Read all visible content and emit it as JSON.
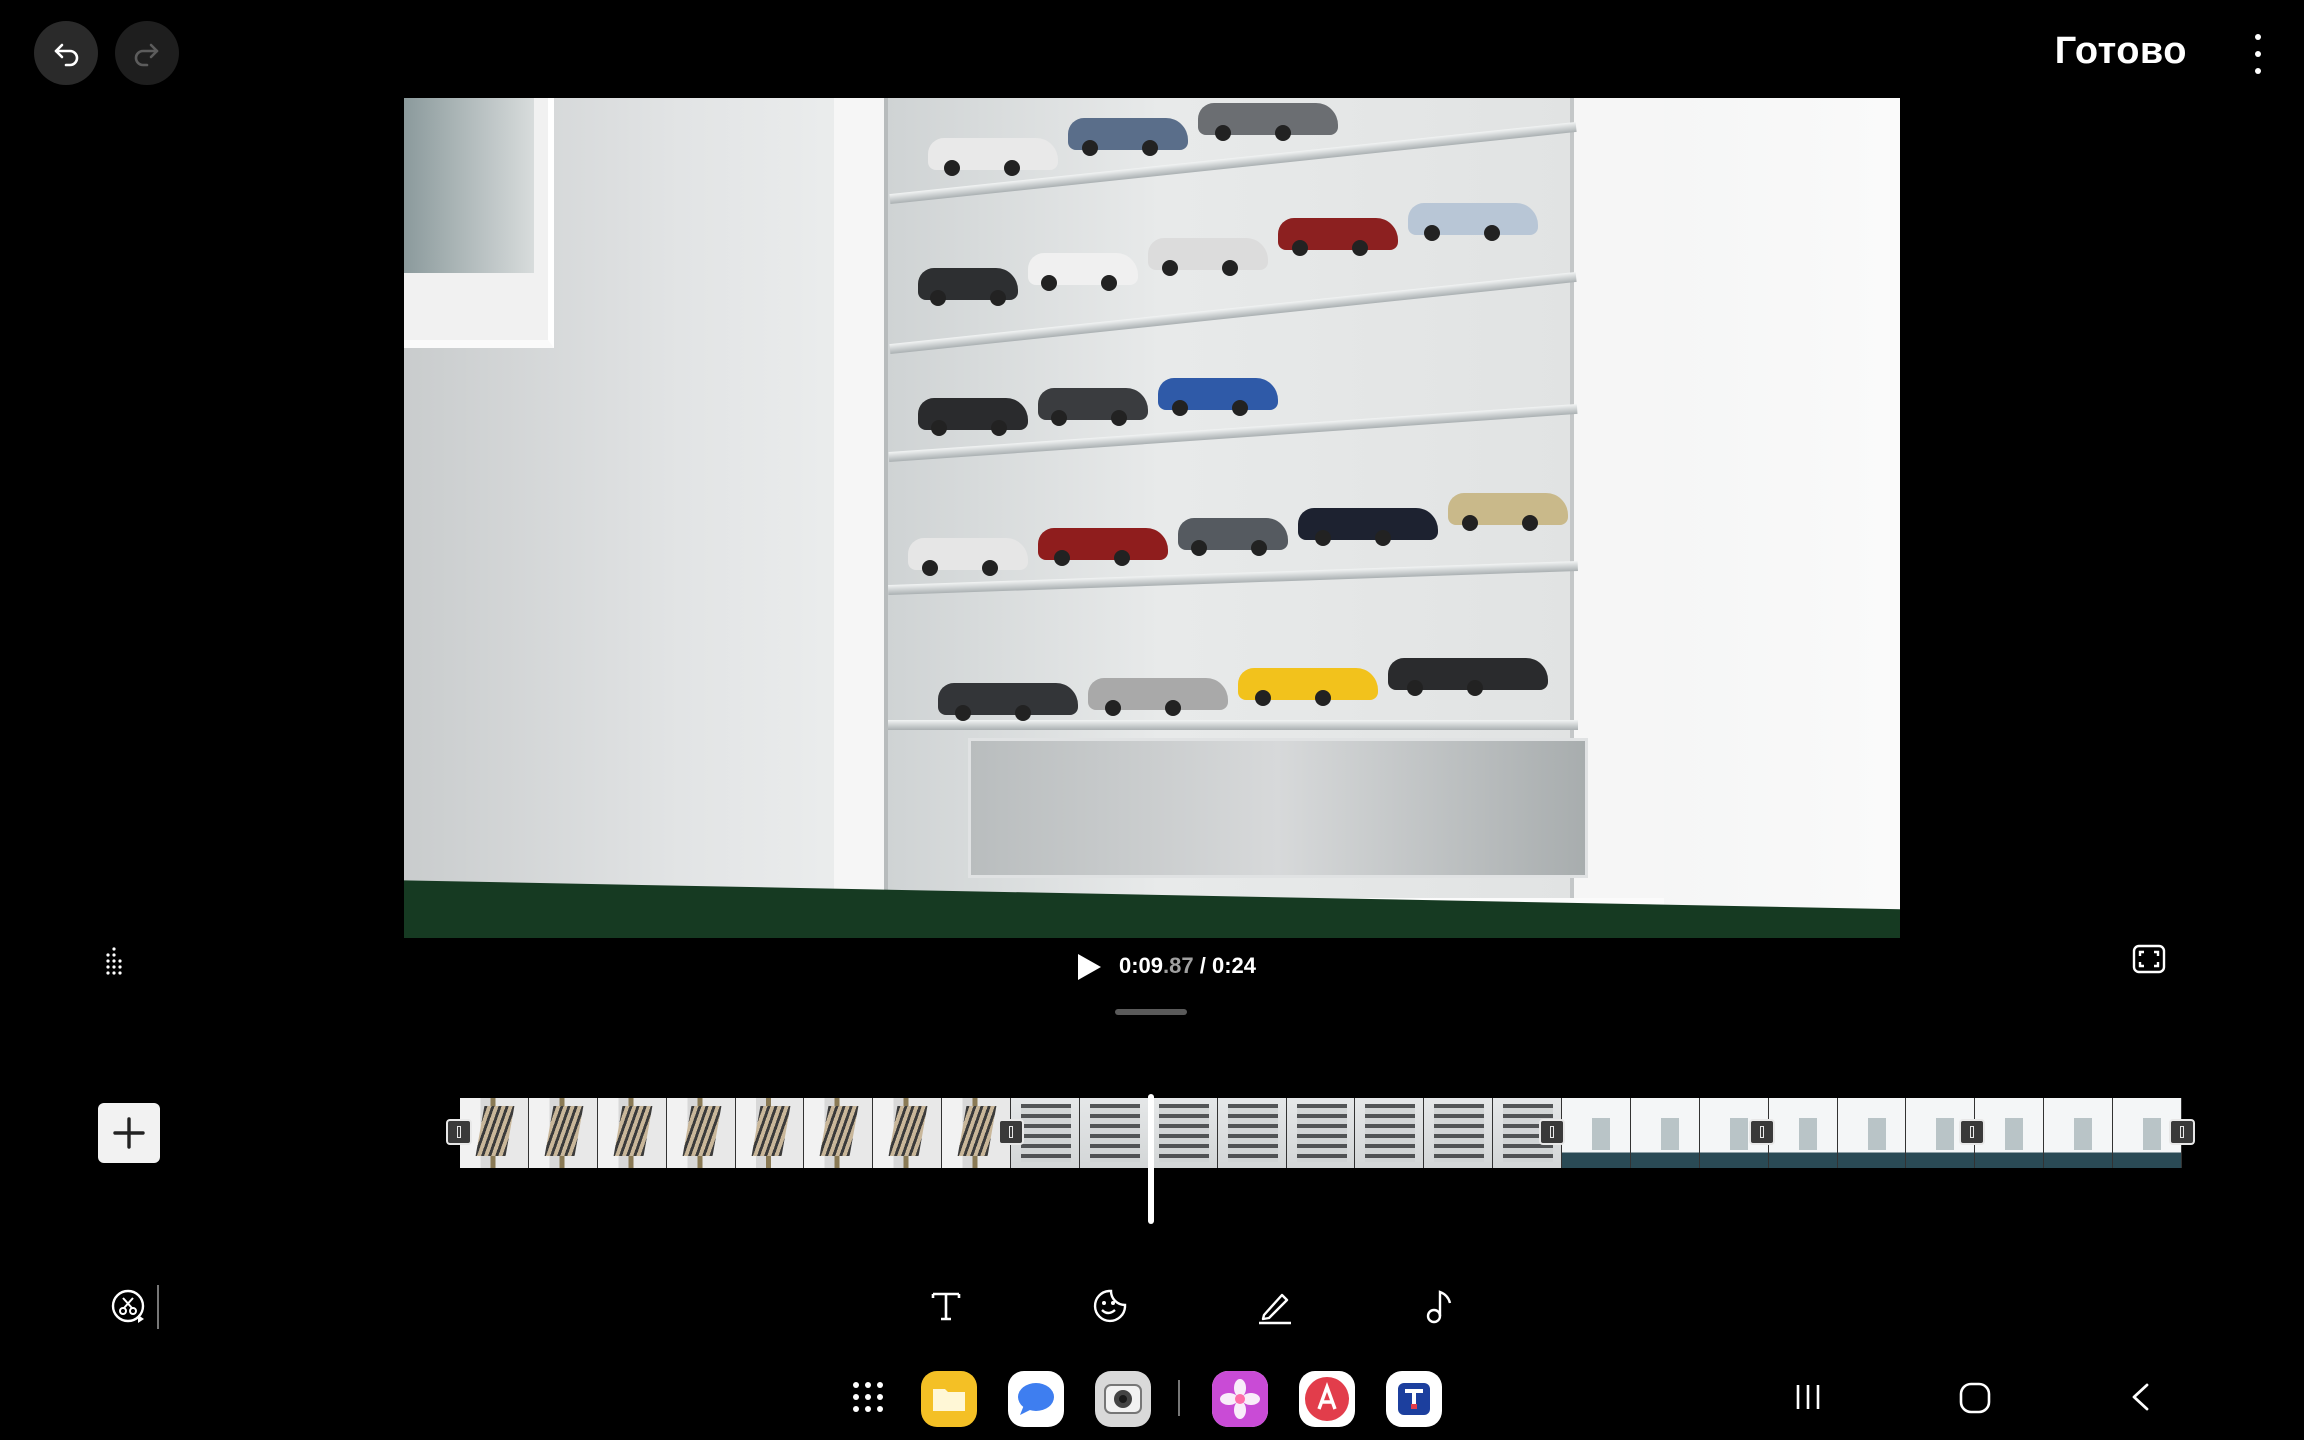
{
  "header": {
    "undo_icon": "undo-icon",
    "redo_icon": "redo-icon",
    "done_label": "Готово",
    "more_icon": "more-vertical-icon"
  },
  "player": {
    "current_time_main": "0:09",
    "current_time_fraction": ".87",
    "separator": " / ",
    "total_time": "0:24",
    "play_icon": "play-icon",
    "fullscreen_icon": "fullscreen-icon",
    "ratio_icon": "grid-dots-icon"
  },
  "timeline": {
    "add_icon": "plus-icon",
    "clips": [
      {
        "style": "a",
        "frames": 8
      },
      {
        "style": "b",
        "frames": 8
      },
      {
        "style": "c",
        "frames": 9
      }
    ],
    "marker_icon": "clip-transition-icon"
  },
  "tools": [
    "trim-speed-icon",
    "text-icon",
    "sticker-icon",
    "draw-icon",
    "music-icon"
  ],
  "navbar": {
    "apps": [
      {
        "name": "app-drawer-icon",
        "color": "#000000"
      },
      {
        "name": "my-files-icon",
        "color": "#f4c025"
      },
      {
        "name": "messages-icon",
        "color": "#ffffff"
      },
      {
        "name": "camera-icon",
        "color": "#d9d9d9"
      },
      {
        "name": "gallery-icon",
        "color": "#ffffff"
      },
      {
        "name": "galaxy-store-icon",
        "color": "#ffffff"
      },
      {
        "name": "t-app-icon",
        "color": "#ffffff"
      }
    ],
    "recents_icon": "recents-icon",
    "home_icon": "home-icon",
    "back_icon": "back-icon"
  }
}
